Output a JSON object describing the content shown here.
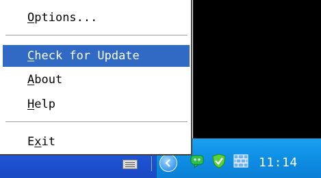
{
  "menu": {
    "items": [
      {
        "prefix": "",
        "accel": "O",
        "suffix": "ptions...",
        "selected": false
      },
      {
        "prefix": "",
        "accel": "C",
        "suffix": "heck for Update",
        "selected": true
      },
      {
        "prefix": "",
        "accel": "A",
        "suffix": "bout",
        "selected": false
      },
      {
        "prefix": "",
        "accel": "H",
        "suffix": "elp",
        "selected": false
      },
      {
        "prefix": "E",
        "accel": "x",
        "suffix": "it",
        "selected": false
      }
    ]
  },
  "taskbar": {
    "clock": "11:14",
    "tray_icons": [
      "keyboard-icon",
      "show-hidden-icons-chevron",
      "chat-icon",
      "security-shield-icon",
      "firewall-icon"
    ]
  },
  "colors": {
    "menu_highlight": "#316ac5",
    "taskbar_blue": "#1f55d4",
    "tray_blue": "#0e8fe4",
    "desktop": "#000000"
  }
}
